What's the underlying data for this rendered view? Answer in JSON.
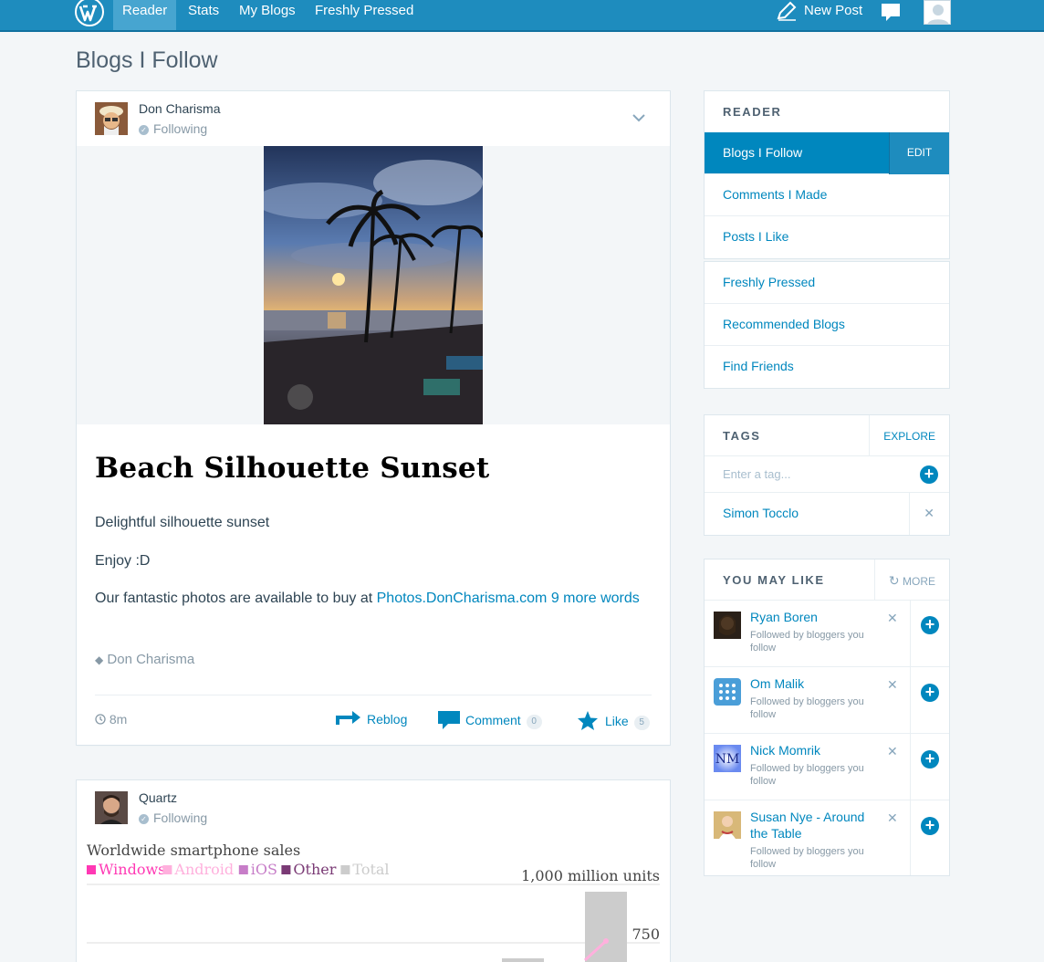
{
  "topbar": {
    "tabs": [
      {
        "label": "Reader"
      },
      {
        "label": "Stats"
      },
      {
        "label": "My Blogs"
      },
      {
        "label": "Freshly Pressed"
      }
    ],
    "new_post": "New Post",
    "colors": {
      "bar": "#1e8cbe",
      "active_tab": "#47a5d0"
    }
  },
  "page_title": "Blogs I Follow",
  "posts": [
    {
      "author": "Don Charisma",
      "follow_status": "Following",
      "title": "Beach Silhouette Sunset",
      "paragraphs": [
        "Delightful silhouette sunset",
        "Enjoy :D"
      ],
      "promo_text": "Our fantastic photos are available to buy at ",
      "promo_link": "Photos.DonCharisma.com",
      "more_link": "9 more words",
      "tag": "Don Charisma",
      "time": "8m",
      "reblog_label": "Reblog",
      "comment_label": "Comment",
      "comment_count": "0",
      "like_label": "Like",
      "like_count": "5"
    },
    {
      "author": "Quartz",
      "follow_status": "Following"
    }
  ],
  "chart_data": {
    "type": "bar",
    "title": "Worldwide smartphone sales",
    "legend": [
      "Windows",
      "Android",
      "iOS",
      "Other",
      "Total"
    ],
    "legend_colors": [
      "#ff38b4",
      "#ffb0dd",
      "#c77dc8",
      "#7a3a75",
      "#cccccc"
    ],
    "y_tick_labels": [
      "1,000 million units",
      "750"
    ],
    "ylim": [
      0,
      1000
    ]
  },
  "sidebar": {
    "reader": {
      "heading": "READER",
      "items": [
        {
          "label": "Blogs I Follow",
          "action": "EDIT"
        },
        {
          "label": "Comments I Made"
        },
        {
          "label": "Posts I Like"
        }
      ]
    },
    "discover": {
      "items": [
        {
          "label": "Freshly Pressed"
        },
        {
          "label": "Recommended Blogs"
        },
        {
          "label": "Find Friends"
        }
      ]
    },
    "tags": {
      "heading": "TAGS",
      "action": "EXPLORE",
      "input_placeholder": "Enter a tag...",
      "items": [
        {
          "label": "Simon Tocclo"
        }
      ]
    },
    "you_may_like": {
      "heading": "YOU MAY LIKE",
      "action": "MORE",
      "items": [
        {
          "name": "Ryan Boren",
          "sub": "Followed by bloggers you follow"
        },
        {
          "name": "Om Malik",
          "sub": "Followed by bloggers you follow"
        },
        {
          "name": "Nick Momrik",
          "sub": "Followed by bloggers you follow"
        },
        {
          "name": "Susan Nye - Around the Table",
          "sub": "Followed by bloggers you follow"
        }
      ]
    }
  }
}
